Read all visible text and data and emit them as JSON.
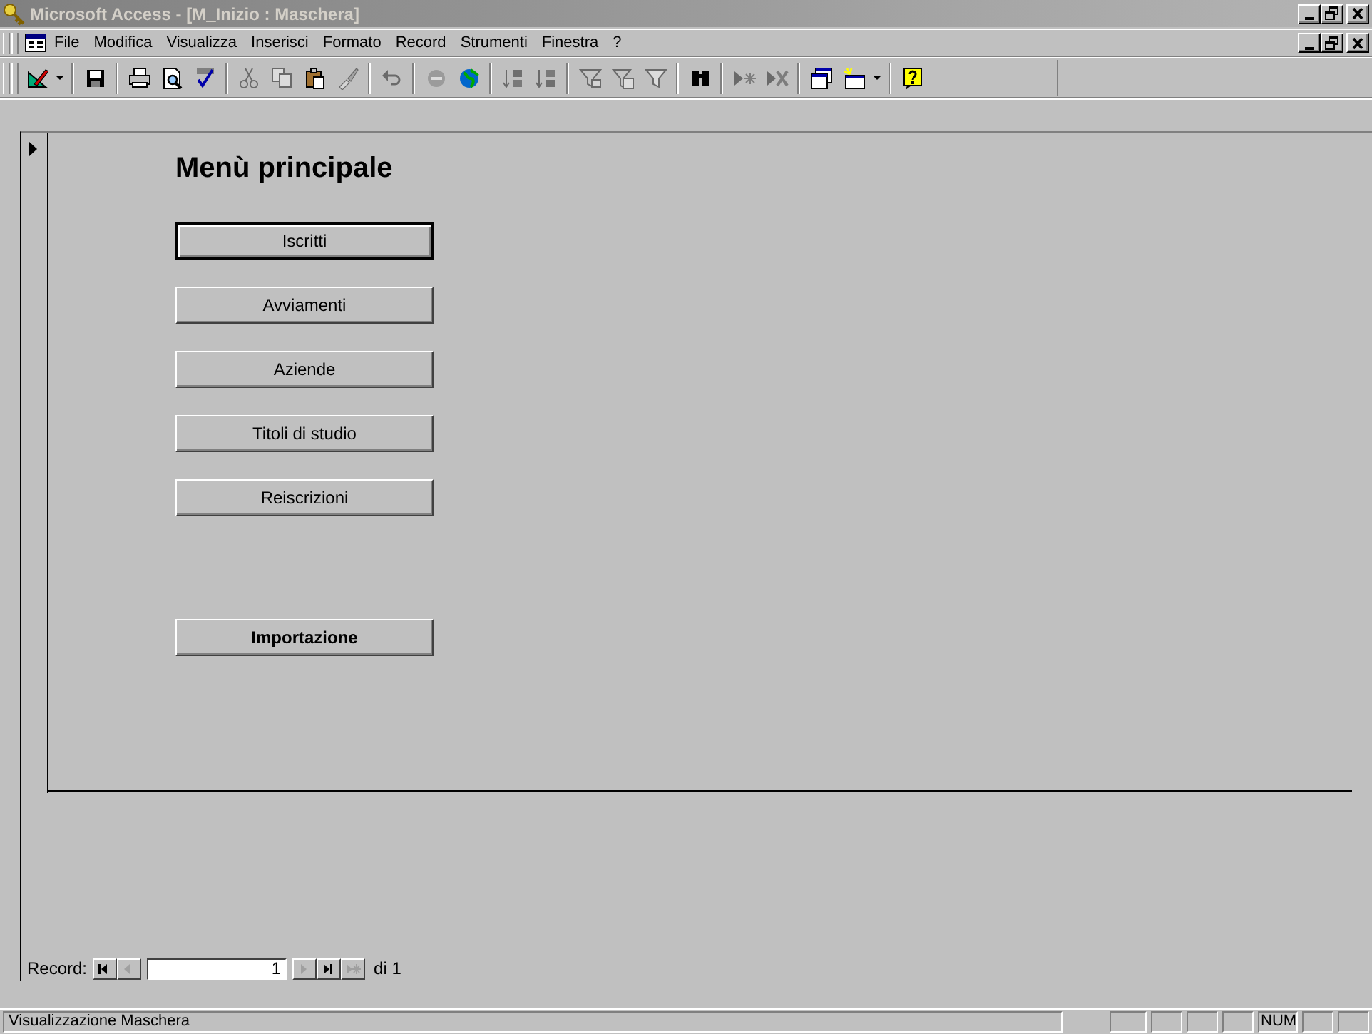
{
  "window": {
    "title": "Microsoft Access - [M_Inizio : Maschera]"
  },
  "menu_bar": {
    "items": [
      "File",
      "Modifica",
      "Visualizza",
      "Inserisci",
      "Formato",
      "Record",
      "Strumenti",
      "Finestra",
      "?"
    ]
  },
  "toolbar": {
    "items": [
      {
        "kind": "button",
        "disabled": false
      },
      {
        "kind": "caret",
        "disabled": false
      },
      {
        "kind": "separator"
      },
      {
        "kind": "button",
        "disabled": false
      },
      {
        "kind": "separator"
      },
      {
        "kind": "button",
        "disabled": false
      },
      {
        "kind": "button",
        "disabled": false
      },
      {
        "kind": "button",
        "disabled": false
      },
      {
        "kind": "separator"
      },
      {
        "kind": "button",
        "disabled": true
      },
      {
        "kind": "button",
        "disabled": true
      },
      {
        "kind": "button",
        "disabled": false
      },
      {
        "kind": "button",
        "disabled": true
      },
      {
        "kind": "separator"
      },
      {
        "kind": "button",
        "disabled": true
      },
      {
        "kind": "separator"
      },
      {
        "kind": "button",
        "disabled": true
      },
      {
        "kind": "button",
        "disabled": false
      },
      {
        "kind": "separator"
      },
      {
        "kind": "button",
        "disabled": true
      },
      {
        "kind": "button",
        "disabled": true
      },
      {
        "kind": "separator"
      },
      {
        "kind": "button",
        "disabled": true
      },
      {
        "kind": "button",
        "disabled": true
      },
      {
        "kind": "button",
        "disabled": true
      },
      {
        "kind": "separator"
      },
      {
        "kind": "button",
        "disabled": false
      },
      {
        "kind": "separator"
      },
      {
        "kind": "button",
        "disabled": true
      },
      {
        "kind": "button",
        "disabled": true
      },
      {
        "kind": "separator"
      },
      {
        "kind": "button",
        "disabled": false
      },
      {
        "kind": "button",
        "disabled": false
      },
      {
        "kind": "caret",
        "disabled": false
      },
      {
        "kind": "separator"
      },
      {
        "kind": "button",
        "disabled": false
      }
    ]
  },
  "form": {
    "heading": "Menù principale",
    "buttons": [
      {
        "label": "Iscritti",
        "focused": true,
        "bold": false
      },
      {
        "label": "Avviamenti",
        "focused": false,
        "bold": false
      },
      {
        "label": "Aziende",
        "focused": false,
        "bold": false
      },
      {
        "label": "Titoli di studio",
        "focused": false,
        "bold": false
      },
      {
        "label": "Reiscrizioni",
        "focused": false,
        "bold": false
      },
      {
        "label": "Importazione",
        "focused": false,
        "bold": true
      }
    ]
  },
  "record_nav": {
    "label": "Record:",
    "current": "1",
    "total": "di 1",
    "buttons": [
      {
        "kind": "first",
        "disabled": false
      },
      {
        "kind": "prev",
        "disabled": true
      },
      {
        "kind": "next",
        "disabled": true
      },
      {
        "kind": "last",
        "disabled": false
      },
      {
        "kind": "new",
        "disabled": true
      }
    ]
  },
  "status_bar": {
    "text": "Visualizzazione Maschera",
    "indicators": [
      "NUM"
    ]
  }
}
